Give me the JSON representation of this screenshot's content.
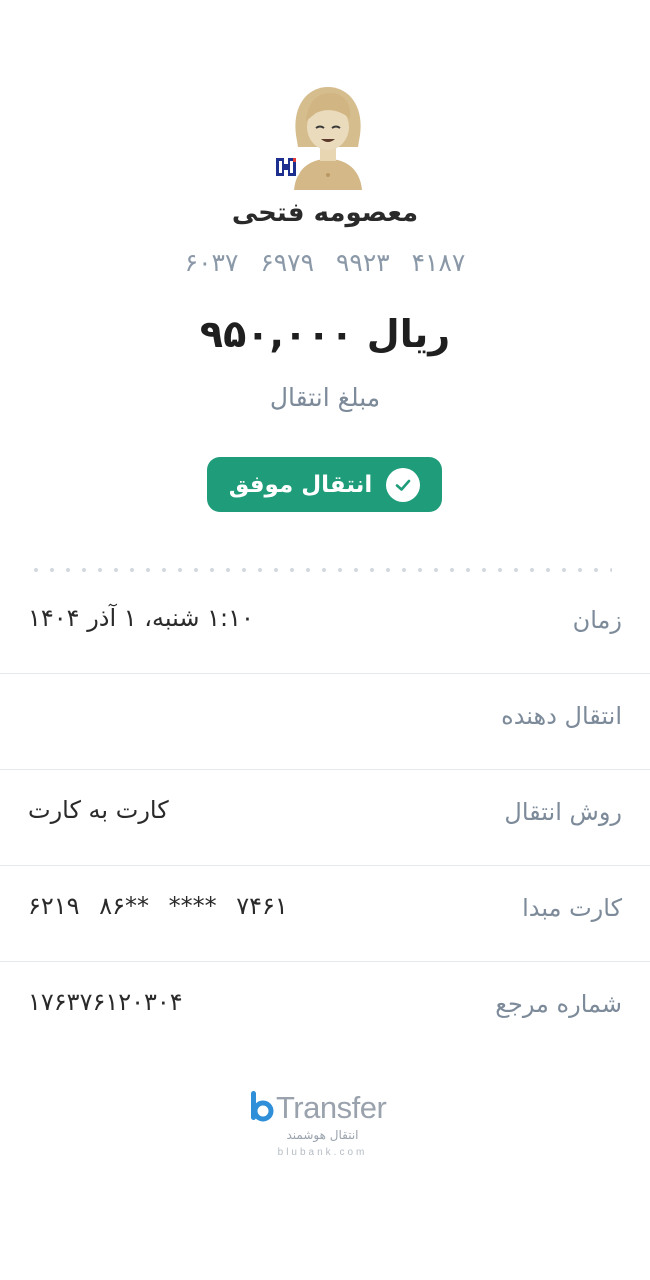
{
  "recipient": {
    "name": "معصومه فتحی",
    "card_number": "۶۰۳۷  ۶۹۷۹  ۹۹۲۳  ۴۱۸۷"
  },
  "transfer": {
    "amount": "۹۵۰,۰۰۰ ریال",
    "amount_label": "مبلغ انتقال",
    "status_label": "انتقال موفق",
    "status_icon": "check-icon",
    "status_color": "#1f9c7a"
  },
  "details": {
    "time": {
      "label": "زمان",
      "value": "۱:۱۰ شنبه، ۱ آذر ۱۴۰۴"
    },
    "sender": {
      "label": "انتقال دهنده",
      "value": ""
    },
    "method": {
      "label": "روش انتقال",
      "value": "کارت به کارت"
    },
    "source_card": {
      "label": "کارت مبدا",
      "value": "۶۲۱۹  ۸۶**  ****  ۷۴۶۱"
    },
    "reference": {
      "label": "شماره مرجع",
      "value": "۱۷۶۳۷۶۱۲۰۳۰۴"
    }
  },
  "brand": {
    "name": "Transfer",
    "tagline": "انتقال هوشمند",
    "domain": "blubank.com",
    "accent_color": "#2f8fd8"
  },
  "icons": {
    "avatar": "user-avatar-icon",
    "bank_logo": "bank-saderat-icon"
  }
}
